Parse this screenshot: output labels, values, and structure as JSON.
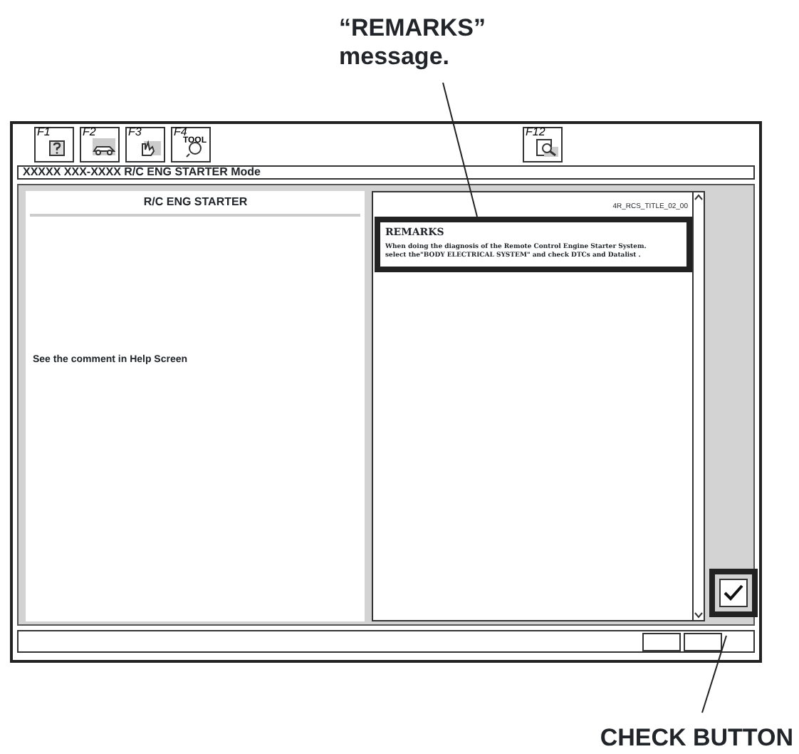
{
  "callouts": [
    {
      "text": "“REMARKS”\nmessage."
    },
    {
      "text": "CHECK BUTTON"
    }
  ],
  "toolbar": {
    "keys": [
      {
        "label": "F1",
        "kind": "help"
      },
      {
        "label": "F2",
        "kind": "car"
      },
      {
        "label": "F3",
        "kind": "hand"
      },
      {
        "label": "F4",
        "kind": "tool",
        "caption": "TOOL"
      },
      {
        "label": "F12",
        "kind": "search"
      }
    ]
  },
  "title_bar": "XXXXX XXX-XXXX R/C ENG STARTER Mode",
  "left_panel": {
    "heading": "R/C ENG STARTER",
    "comment": "See the comment in Help Screen"
  },
  "right_panel": {
    "code": "4R_RCS_TITLE_02_00",
    "remarks": {
      "title": "REMARKS",
      "text": "When doing the diagnosis of the Remote Control Engine Starter System.\nselect the\"BODY ELECTRICAL SYSTEM\" and check DTCs and Datalist ."
    }
  }
}
